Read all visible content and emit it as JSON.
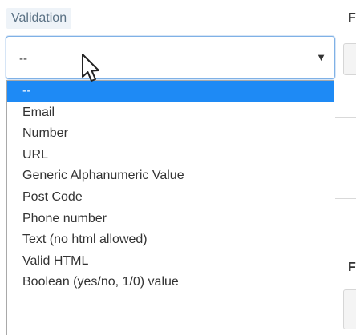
{
  "field": {
    "label": "Validation",
    "selected_value": "--",
    "arrow_icon": "triangle-down-icon"
  },
  "side": {
    "top_label": "F",
    "bottom_label": "F"
  },
  "dropdown": {
    "options": [
      {
        "label": "--",
        "selected": true
      },
      {
        "label": "Email",
        "selected": false
      },
      {
        "label": "Number",
        "selected": false
      },
      {
        "label": "URL",
        "selected": false
      },
      {
        "label": "Generic Alphanumeric Value",
        "selected": false
      },
      {
        "label": "Post Code",
        "selected": false
      },
      {
        "label": "Phone number",
        "selected": false
      },
      {
        "label": "Text (no html allowed)",
        "selected": false
      },
      {
        "label": "Valid HTML",
        "selected": false
      },
      {
        "label": "Boolean (yes/no, 1/0) value",
        "selected": false
      }
    ]
  },
  "colors": {
    "highlight": "#1e8af5",
    "focus_border": "#7fb1e6",
    "label_text": "#5a7184"
  }
}
